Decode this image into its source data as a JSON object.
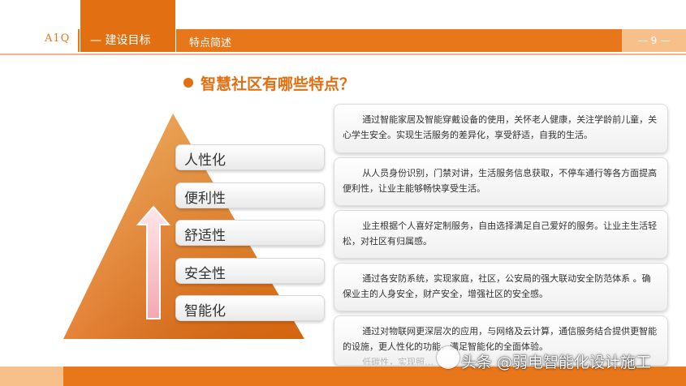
{
  "header": {
    "logo_text": "A1Q",
    "tab_label": "— 建设目标",
    "subtitle": "特点简述",
    "page_number": "— 9 —"
  },
  "main": {
    "title": "智慧社区有哪些特点？"
  },
  "pyramid": {
    "levels": [
      "人性化",
      "便利性",
      "舒适性",
      "安全性",
      "智能化"
    ]
  },
  "descriptions": [
    "通过智能家居及智能穿戴设备的使用，关怀老人健康，关注学龄前儿童，关心学生安全。实现生活服务的差异化，享受舒适，自我的生活。",
    "从人员身份识别，门禁对讲，生活服务信息获取，不停车通行等各方面提高便利性，让业主能够畅快享受生活。",
    "业主根据个人喜好定制服务，自由选择满足自己爱好的服务。让业主生活轻松，对社区有归属感。",
    "通过各安防系统，实现家庭，社区，公安局的强大联动安全防范体系 。确保业主的人身安全，财产安全，增强社区的安全感。",
    "通过对物联网更深层次的应用，与网络及云计算，通信服务结合提供更智能的设施，更人性化的功能，满足智能化的全面体验。",
    "低碳性，实现照…"
  ],
  "watermark": "头条 @弱电智能化设计施工",
  "colors": {
    "accent": "#e8771b",
    "accent_dark": "#e26f12",
    "accent_light": "#f7c08a"
  }
}
